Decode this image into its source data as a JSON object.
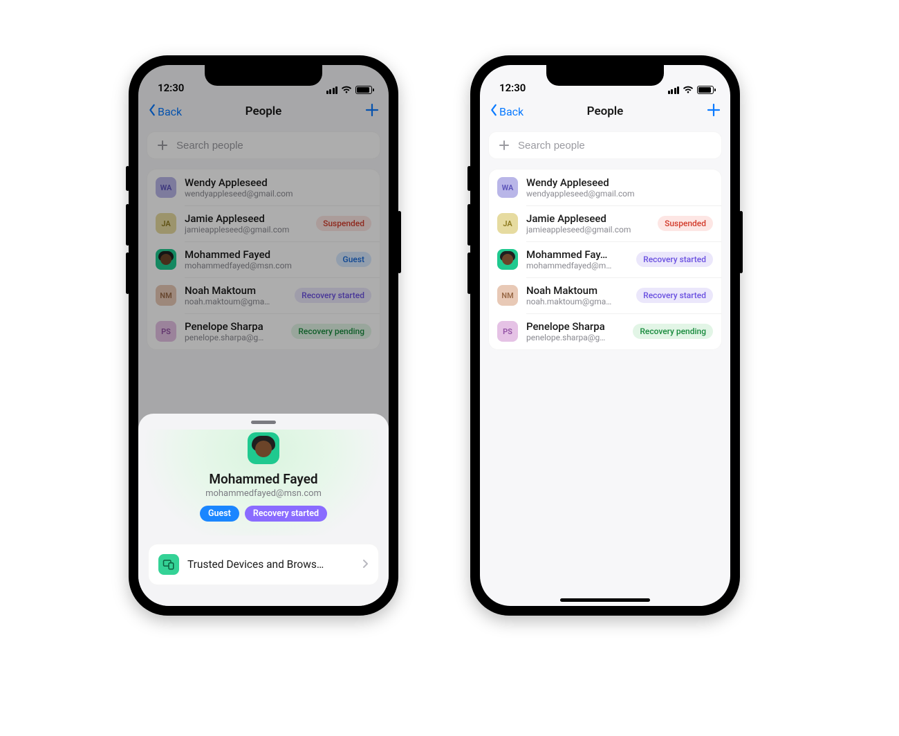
{
  "status": {
    "time": "12:30"
  },
  "nav": {
    "back": "Back",
    "title": "People"
  },
  "search": {
    "placeholder": "Search people"
  },
  "left": {
    "people": [
      {
        "name": "Wendy Appleseed",
        "email": "wendyappleseed@gmail.com",
        "initials": "WA",
        "avatar_color": "#b9b6e8",
        "avatar_text": "#5a52b8",
        "badge": null
      },
      {
        "name": "Jamie Appleseed",
        "email": "jamieappleseed@gmail.com",
        "initials": "JA",
        "avatar_color": "#e6dba0",
        "avatar_text": "#8d7a1e",
        "badge": "Suspended",
        "badge_class": "suspended"
      },
      {
        "name": "Mohammed Fayed",
        "email": "mohammedfayed@msn.com",
        "photo": true,
        "badge": "Guest",
        "badge_class": "guest"
      },
      {
        "name": "Noah Maktoum",
        "email": "noah.maktoum@gma…",
        "initials": "NM",
        "avatar_color": "#e8c9b6",
        "avatar_text": "#9a6a48",
        "badge": "Recovery started",
        "badge_class": "rec-started"
      },
      {
        "name": "Penelope Sharpa",
        "email": "penelope.sharpa@g…",
        "initials": "PS",
        "avatar_color": "#e5c2e5",
        "avatar_text": "#9150a3",
        "badge": "Recovery pending",
        "badge_class": "rec-pending"
      }
    ]
  },
  "right": {
    "people": [
      {
        "name": "Wendy Appleseed",
        "email": "wendyappleseed@gmail.com",
        "initials": "WA",
        "avatar_color": "#b9b6e8",
        "avatar_text": "#5a52b8",
        "badge": null
      },
      {
        "name": "Jamie Appleseed",
        "email": "jamieappleseed@gmail.com",
        "initials": "JA",
        "avatar_color": "#e6dba0",
        "avatar_text": "#8d7a1e",
        "badge": "Suspended",
        "badge_class": "suspended"
      },
      {
        "name": "Mohammed Fay…",
        "email": "mohammedfayed@m…",
        "photo": true,
        "badge": "Recovery started",
        "badge_class": "rec-started"
      },
      {
        "name": "Noah Maktoum",
        "email": "noah.maktoum@gma…",
        "initials": "NM",
        "avatar_color": "#e8c9b6",
        "avatar_text": "#9a6a48",
        "badge": "Recovery started",
        "badge_class": "rec-started"
      },
      {
        "name": "Penelope Sharpa",
        "email": "penelope.sharpa@g…",
        "initials": "PS",
        "avatar_color": "#e5c2e5",
        "avatar_text": "#9150a3",
        "badge": "Recovery pending",
        "badge_class": "rec-pending"
      }
    ]
  },
  "sheet": {
    "name": "Mohammed Fayed",
    "email": "mohammedfayed@msn.com",
    "badges": [
      {
        "label": "Guest",
        "class": "guest"
      },
      {
        "label": "Recovery started",
        "class": "recstart"
      }
    ],
    "item_label": "Trusted Devices and Brows…"
  }
}
